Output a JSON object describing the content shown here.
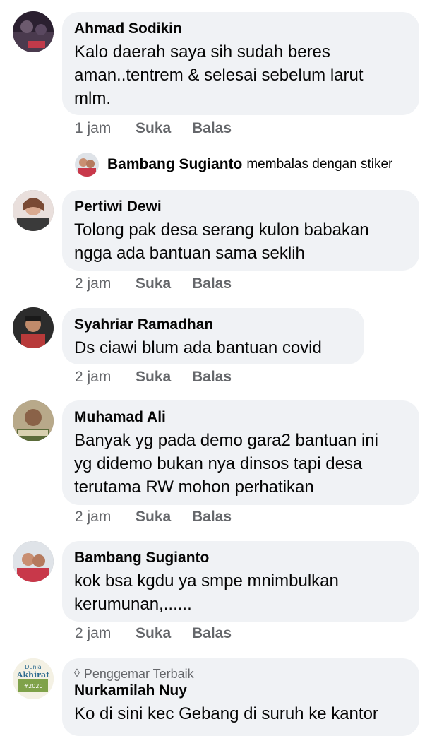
{
  "comments": [
    {
      "name": "Ahmad Sodikin",
      "text": "Kalo daerah saya sih sudah beres\naman..tentrem & selesai sebelum larut\nmlm.",
      "time": "1 jam",
      "like": "Suka",
      "reply": "Balas"
    },
    {
      "name": "Pertiwi Dewi",
      "text": "Tolong pak desa serang kulon babakan\nngga ada bantuan sama seklih",
      "time": "2 jam",
      "like": "Suka",
      "reply": "Balas"
    },
    {
      "name": "Syahriar Ramadhan",
      "text": "Ds ciawi blum ada bantuan covid",
      "time": "2 jam",
      "like": "Suka",
      "reply": "Balas"
    },
    {
      "name": "Muhamad Ali",
      "text": "Banyak yg pada demo gara2 bantuan ini\nyg didemo bukan nya dinsos tapi desa\nterutama RW mohon perhatikan",
      "time": "2 jam",
      "like": "Suka",
      "reply": "Balas"
    },
    {
      "name": "Bambang Sugianto",
      "text": "kok bsa kgdu ya smpe mnimbulkan\nkerumunan,......",
      "time": "2 jam",
      "like": "Suka",
      "reply": "Balas"
    },
    {
      "badge": "Penggemar Terbaik",
      "name": "Nurkamilah Nuy",
      "text": "Ko di sini kec Gebang di suruh ke kantor"
    }
  ],
  "sticker_reply": {
    "name": "Bambang Sugianto",
    "text": "membalas dengan stiker"
  },
  "avatar_sticker_text": {
    "line1": "Dunia",
    "line2": "Akhirat",
    "line3": "#2020"
  },
  "icons": {
    "badge": "diamond-icon"
  }
}
